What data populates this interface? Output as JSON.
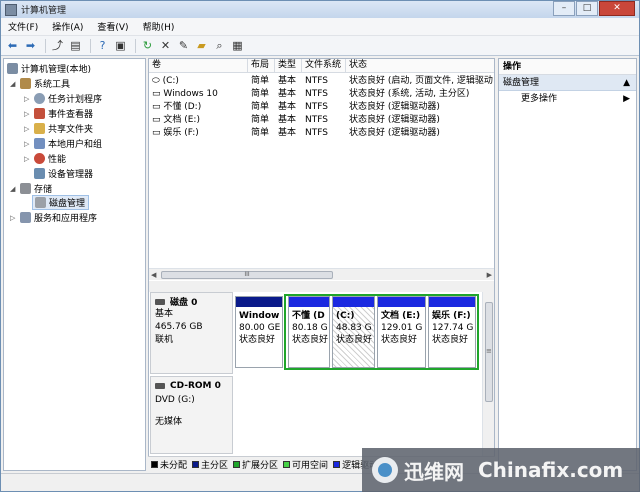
{
  "window": {
    "title": "计算机管理"
  },
  "menu": [
    "文件(F)",
    "操作(A)",
    "查看(V)",
    "帮助(H)"
  ],
  "toolbar_icons": [
    "back-icon",
    "forward-icon",
    "up-folder-icon",
    "show-hide-tree-icon",
    "help-icon",
    "properties-icon",
    "refresh-icon",
    "delete-icon",
    "new-icon",
    "open-folder-icon",
    "search-icon",
    "export-icon"
  ],
  "tree": {
    "root": "计算机管理(本地)",
    "system_tools": "系统工具",
    "task_scheduler": "任务计划程序",
    "event_viewer": "事件查看器",
    "shared_folders": "共享文件夹",
    "local_users": "本地用户和组",
    "performance": "性能",
    "device_manager": "设备管理器",
    "storage": "存储",
    "disk_management": "磁盘管理",
    "services_apps": "服务和应用程序"
  },
  "volume_table": {
    "headers": [
      "卷",
      "布局",
      "类型",
      "文件系统",
      "状态"
    ],
    "rows": [
      [
        "(C:)",
        "简单",
        "基本",
        "NTFS",
        "状态良好 (启动, 页面文件, 逻辑驱动"
      ],
      [
        "Windows 10",
        "简单",
        "基本",
        "NTFS",
        "状态良好 (系统, 活动, 主分区)"
      ],
      [
        "不懂 (D:)",
        "简单",
        "基本",
        "NTFS",
        "状态良好 (逻辑驱动器)"
      ],
      [
        "文档 (E:)",
        "简单",
        "基本",
        "NTFS",
        "状态良好 (逻辑驱动器)"
      ],
      [
        "娱乐 (F:)",
        "简单",
        "基本",
        "NTFS",
        "状态良好 (逻辑驱动器)"
      ]
    ]
  },
  "disks": {
    "disk0": {
      "name": "磁盘 0",
      "type": "基本",
      "size": "465.76 GB",
      "state": "联机"
    },
    "cdrom0": {
      "name": "CD-ROM 0",
      "drive": "DVD (G:)",
      "media": "无媒体"
    }
  },
  "partitions": [
    {
      "name": "Window",
      "size": "80.00 GE",
      "status": "状态良好"
    },
    {
      "name": "不懂 (D",
      "size": "80.18 G",
      "status": "状态良好"
    },
    {
      "name": "(C:)",
      "size": "48.83 G",
      "status": "状态良好"
    },
    {
      "name": "文档 (E:)",
      "size": "129.01 G",
      "status": "状态良好"
    },
    {
      "name": "娱乐 (F:)",
      "size": "127.74 G",
      "status": "状态良好"
    }
  ],
  "legend": [
    {
      "label": "未分配",
      "color": "#000000"
    },
    {
      "label": "主分区",
      "color": "#0a1a8a"
    },
    {
      "label": "扩展分区",
      "color": "#1fa52b"
    },
    {
      "label": "可用空间",
      "color": "#46d146"
    },
    {
      "label": "逻辑驱动器",
      "color": "#1b29e0"
    }
  ],
  "actions": {
    "header": "操作",
    "section": "磁盘管理",
    "more": "更多操作"
  },
  "watermark": {
    "cn": "迅维网",
    "en": "Chinafix.com"
  },
  "hscroll_grip": "III",
  "vscroll_grip": "≡"
}
